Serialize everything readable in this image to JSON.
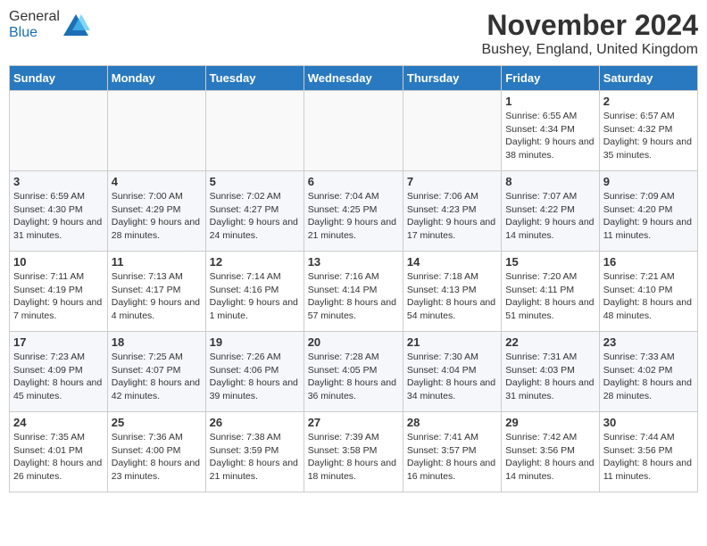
{
  "header": {
    "logo_general": "General",
    "logo_blue": "Blue",
    "month_year": "November 2024",
    "location": "Bushey, England, United Kingdom"
  },
  "days_of_week": [
    "Sunday",
    "Monday",
    "Tuesday",
    "Wednesday",
    "Thursday",
    "Friday",
    "Saturday"
  ],
  "weeks": [
    [
      {
        "day": "",
        "info": ""
      },
      {
        "day": "",
        "info": ""
      },
      {
        "day": "",
        "info": ""
      },
      {
        "day": "",
        "info": ""
      },
      {
        "day": "",
        "info": ""
      },
      {
        "day": "1",
        "info": "Sunrise: 6:55 AM\nSunset: 4:34 PM\nDaylight: 9 hours and 38 minutes."
      },
      {
        "day": "2",
        "info": "Sunrise: 6:57 AM\nSunset: 4:32 PM\nDaylight: 9 hours and 35 minutes."
      }
    ],
    [
      {
        "day": "3",
        "info": "Sunrise: 6:59 AM\nSunset: 4:30 PM\nDaylight: 9 hours and 31 minutes."
      },
      {
        "day": "4",
        "info": "Sunrise: 7:00 AM\nSunset: 4:29 PM\nDaylight: 9 hours and 28 minutes."
      },
      {
        "day": "5",
        "info": "Sunrise: 7:02 AM\nSunset: 4:27 PM\nDaylight: 9 hours and 24 minutes."
      },
      {
        "day": "6",
        "info": "Sunrise: 7:04 AM\nSunset: 4:25 PM\nDaylight: 9 hours and 21 minutes."
      },
      {
        "day": "7",
        "info": "Sunrise: 7:06 AM\nSunset: 4:23 PM\nDaylight: 9 hours and 17 minutes."
      },
      {
        "day": "8",
        "info": "Sunrise: 7:07 AM\nSunset: 4:22 PM\nDaylight: 9 hours and 14 minutes."
      },
      {
        "day": "9",
        "info": "Sunrise: 7:09 AM\nSunset: 4:20 PM\nDaylight: 9 hours and 11 minutes."
      }
    ],
    [
      {
        "day": "10",
        "info": "Sunrise: 7:11 AM\nSunset: 4:19 PM\nDaylight: 9 hours and 7 minutes."
      },
      {
        "day": "11",
        "info": "Sunrise: 7:13 AM\nSunset: 4:17 PM\nDaylight: 9 hours and 4 minutes."
      },
      {
        "day": "12",
        "info": "Sunrise: 7:14 AM\nSunset: 4:16 PM\nDaylight: 9 hours and 1 minute."
      },
      {
        "day": "13",
        "info": "Sunrise: 7:16 AM\nSunset: 4:14 PM\nDaylight: 8 hours and 57 minutes."
      },
      {
        "day": "14",
        "info": "Sunrise: 7:18 AM\nSunset: 4:13 PM\nDaylight: 8 hours and 54 minutes."
      },
      {
        "day": "15",
        "info": "Sunrise: 7:20 AM\nSunset: 4:11 PM\nDaylight: 8 hours and 51 minutes."
      },
      {
        "day": "16",
        "info": "Sunrise: 7:21 AM\nSunset: 4:10 PM\nDaylight: 8 hours and 48 minutes."
      }
    ],
    [
      {
        "day": "17",
        "info": "Sunrise: 7:23 AM\nSunset: 4:09 PM\nDaylight: 8 hours and 45 minutes."
      },
      {
        "day": "18",
        "info": "Sunrise: 7:25 AM\nSunset: 4:07 PM\nDaylight: 8 hours and 42 minutes."
      },
      {
        "day": "19",
        "info": "Sunrise: 7:26 AM\nSunset: 4:06 PM\nDaylight: 8 hours and 39 minutes."
      },
      {
        "day": "20",
        "info": "Sunrise: 7:28 AM\nSunset: 4:05 PM\nDaylight: 8 hours and 36 minutes."
      },
      {
        "day": "21",
        "info": "Sunrise: 7:30 AM\nSunset: 4:04 PM\nDaylight: 8 hours and 34 minutes."
      },
      {
        "day": "22",
        "info": "Sunrise: 7:31 AM\nSunset: 4:03 PM\nDaylight: 8 hours and 31 minutes."
      },
      {
        "day": "23",
        "info": "Sunrise: 7:33 AM\nSunset: 4:02 PM\nDaylight: 8 hours and 28 minutes."
      }
    ],
    [
      {
        "day": "24",
        "info": "Sunrise: 7:35 AM\nSunset: 4:01 PM\nDaylight: 8 hours and 26 minutes."
      },
      {
        "day": "25",
        "info": "Sunrise: 7:36 AM\nSunset: 4:00 PM\nDaylight: 8 hours and 23 minutes."
      },
      {
        "day": "26",
        "info": "Sunrise: 7:38 AM\nSunset: 3:59 PM\nDaylight: 8 hours and 21 minutes."
      },
      {
        "day": "27",
        "info": "Sunrise: 7:39 AM\nSunset: 3:58 PM\nDaylight: 8 hours and 18 minutes."
      },
      {
        "day": "28",
        "info": "Sunrise: 7:41 AM\nSunset: 3:57 PM\nDaylight: 8 hours and 16 minutes."
      },
      {
        "day": "29",
        "info": "Sunrise: 7:42 AM\nSunset: 3:56 PM\nDaylight: 8 hours and 14 minutes."
      },
      {
        "day": "30",
        "info": "Sunrise: 7:44 AM\nSunset: 3:56 PM\nDaylight: 8 hours and 11 minutes."
      }
    ]
  ]
}
